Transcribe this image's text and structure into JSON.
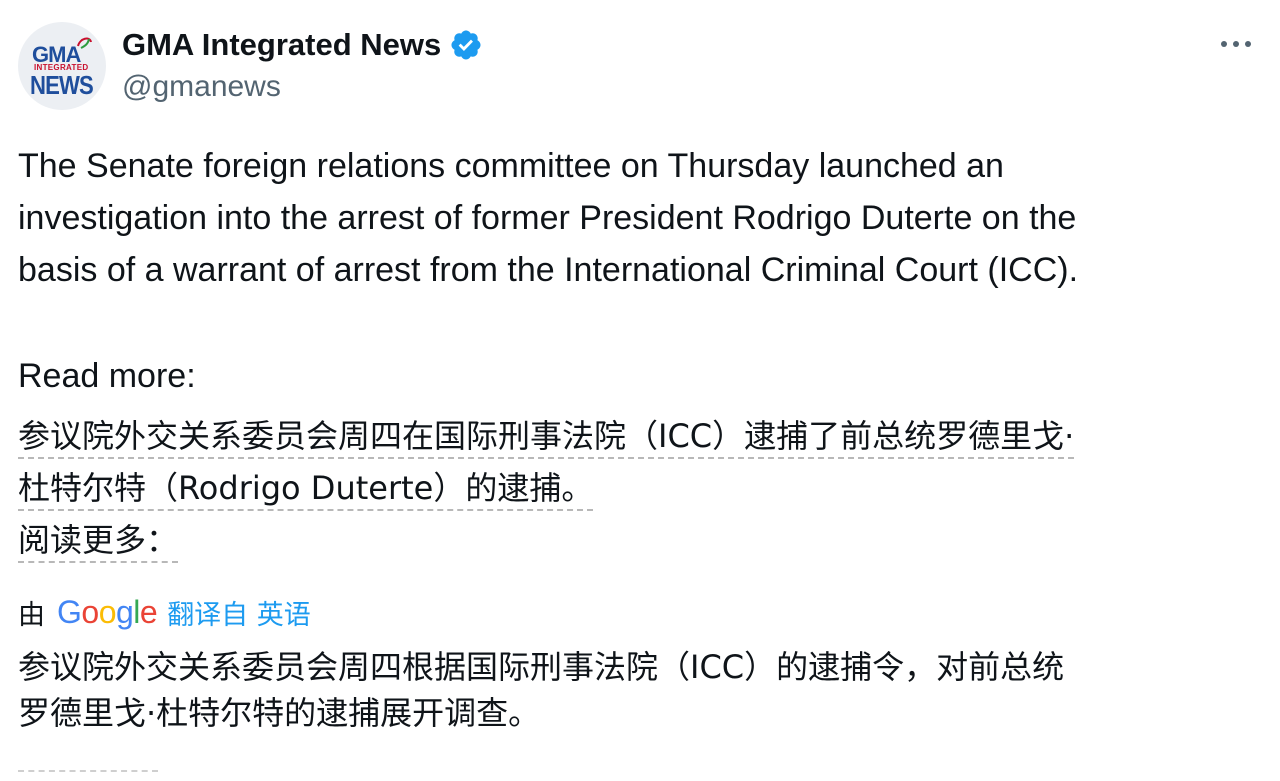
{
  "account": {
    "display_name": "GMA Integrated News",
    "handle": "@gmanews",
    "avatar_logo": {
      "top": "GMA",
      "middle": "INTEGRATED",
      "bottom": "NEWS"
    },
    "verified_icon": "verified-badge-icon",
    "more_icon": "more-options-icon"
  },
  "tweet": {
    "lines": [
      "The Senate foreign relations committee on Thursday launched an",
      "investigation into the arrest of former President Rodrigo Duterte on the",
      "basis of a warrant of arrest from the International Criminal Court (ICC)."
    ],
    "read_more": "Read more:"
  },
  "hover_translation": {
    "lines": [
      "参议院外交关系委员会周四在国际刑事法院（ICC）逮捕了前总统罗德里戈·",
      "杜特尔特（Rodrigo Duterte）的逮捕。",
      "阅读更多："
    ]
  },
  "translation_bar": {
    "prefix": "由",
    "provider": "Google",
    "link_label": "翻译自 英语"
  },
  "translated": {
    "lines": [
      "参议院外交关系委员会周四根据国际刑事法院（ICC）的逮捕令，对前总统",
      "罗德里戈·杜特尔特的逮捕展开调查。"
    ]
  },
  "colors": {
    "text": "#0f1419",
    "secondary": "#536471",
    "accent": "#1d9bf0",
    "verified": "#1d9bf0"
  }
}
